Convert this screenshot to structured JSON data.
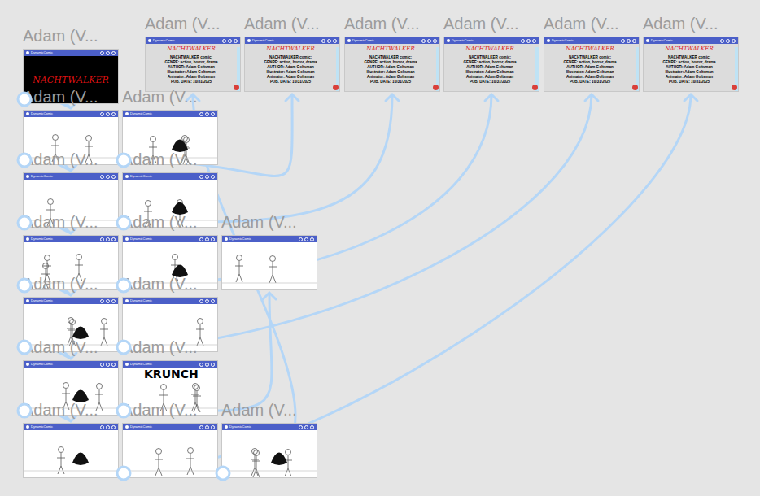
{
  "app_name": "DynamicComic",
  "frames": [
    {
      "label": "Adam (V...",
      "kind": "cover",
      "title": "NACHTWALKER"
    },
    {
      "label": "Adam (V...",
      "kind": "credits",
      "title": "NACHTWALKER",
      "lines": [
        "NACHTWALKER comic:",
        "GENRE: action, horror, drama",
        "AUTHOR: Adam Goltsman",
        "Illustrator: Adam Goltsman",
        "Animator: Adam Goltsman",
        "PUB. DATE: 10/31/2025"
      ]
    },
    {
      "label": "Adam (V...",
      "kind": "credits",
      "title": "NACHTWALKER",
      "lines": [
        "NACHTWALKER comic:",
        "GENRE: action, horror, drama",
        "AUTHOR: Adam Goltsman",
        "Illustrator: Adam Goltsman",
        "Animator: Adam Goltsman",
        "PUB. DATE: 10/31/2025"
      ]
    },
    {
      "label": "Adam (V...",
      "kind": "credits",
      "title": "NACHTWALKER",
      "lines": [
        "NACHTWALKER comic:",
        "GENRE: action, horror, drama",
        "AUTHOR: Adam Goltsman",
        "Illustrator: Adam Goltsman",
        "Animator: Adam Goltsman",
        "PUB. DATE: 10/31/2025"
      ]
    },
    {
      "label": "Adam (V...",
      "kind": "credits",
      "title": "NACHTWALKER",
      "lines": [
        "NACHTWALKER comic:",
        "GENRE: action, horror, drama",
        "AUTHOR: Adam Goltsman",
        "Illustrator: Adam Goltsman",
        "Animator: Adam Goltsman",
        "PUB. DATE: 10/31/2025"
      ]
    },
    {
      "label": "Adam (V...",
      "kind": "credits",
      "title": "NACHTWALKER",
      "lines": [
        "NACHTWALKER comic:",
        "GENRE: action, horror, drama",
        "AUTHOR: Adam Goltsman",
        "Illustrator: Adam Goltsman",
        "Animator: Adam Goltsman",
        "PUB. DATE: 10/31/2025"
      ]
    },
    {
      "label": "Adam (V...",
      "kind": "credits",
      "title": "NACHTWALKER",
      "lines": [
        "NACHTWALKER comic:",
        "GENRE: action, horror, drama",
        "AUTHOR: Adam Goltsman",
        "Illustrator: Adam Goltsman",
        "Animator: Adam Goltsman",
        "PUB. DATE: 10/31/2025"
      ]
    },
    {
      "label": "Adam (V...",
      "kind": "panel"
    },
    {
      "label": "Adam (V...",
      "kind": "panel"
    },
    {
      "label": "Adam (V...",
      "kind": "panel"
    },
    {
      "label": "Adam (V...",
      "kind": "panel"
    },
    {
      "label": "Adam (V...",
      "kind": "panel"
    },
    {
      "label": "Adam (V...",
      "kind": "panel"
    },
    {
      "label": "Adam (V...",
      "kind": "panel"
    },
    {
      "label": "Adam (V...",
      "kind": "panel"
    },
    {
      "label": "Adam (V...",
      "kind": "panel"
    },
    {
      "label": "Adam (V...",
      "kind": "panel"
    },
    {
      "label": "Adam (V...",
      "kind": "panel",
      "caption": "KRUNCH"
    },
    {
      "label": "Adam (V...",
      "kind": "panel"
    },
    {
      "label": "Adam (V...",
      "kind": "panel"
    },
    {
      "label": "Adam (V...",
      "kind": "panel"
    }
  ],
  "connections": [
    {
      "from": 0,
      "to": 7
    },
    {
      "from": 7,
      "to": 9
    },
    {
      "from": 9,
      "to": 11
    },
    {
      "from": 11,
      "to": 14
    },
    {
      "from": 14,
      "to": 16
    },
    {
      "from": 16,
      "to": 18
    },
    {
      "from": 8,
      "to": 2
    },
    {
      "from": 10,
      "to": 3
    },
    {
      "from": 12,
      "to": 4
    },
    {
      "from": 15,
      "to": 5
    },
    {
      "from": 19,
      "to": 6
    },
    {
      "from": 17,
      "to": 13
    },
    {
      "from": 20,
      "to": 1
    }
  ]
}
